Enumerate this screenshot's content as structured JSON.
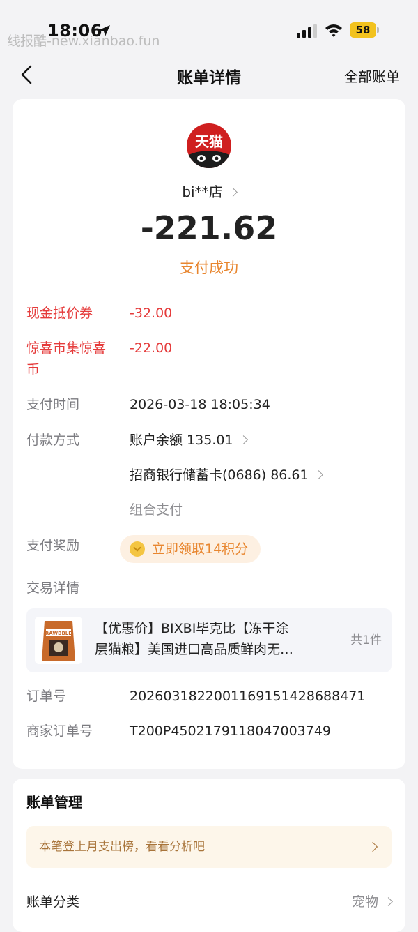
{
  "status_bar": {
    "time": "18:06",
    "battery": "58"
  },
  "watermark": "线报酷-new.xianbao.fun",
  "nav": {
    "title": "账单详情",
    "right_link": "全部账单"
  },
  "merchant": {
    "logo_text": "天猫",
    "name": "bi**店",
    "amount": "-221.62",
    "status": "支付成功"
  },
  "details": {
    "coupon_label": "现金抵价券",
    "coupon_value": "-32.00",
    "coin_label_1": "惊喜市集惊喜",
    "coin_label_2": "币",
    "coin_value": "-22.00",
    "time_label": "支付时间",
    "time_value": "2026-03-18 18:05:34",
    "method_label": "付款方式",
    "method_1": "账户余额 135.01",
    "method_2": "招商银行储蓄卡(0686) 86.61",
    "method_3": "组合支付",
    "reward_label": "支付奖励",
    "reward_text": "立即领取14积分",
    "trade_label": "交易详情",
    "order_label": "订单号",
    "order_value": "2026031822001169151428688471",
    "merchant_order_label": "商家订单号",
    "merchant_order_value": "T200P4502179118047003749"
  },
  "product": {
    "title_line1": "【优惠价】BIXBI毕克比【冻干涂",
    "title_line2": "层猫粮】美国进口高品质鲜肉无…",
    "count": "共1件",
    "thumb_text": "RAWBBLE"
  },
  "management": {
    "title": "账单管理",
    "banner_text": "本笔登上月支出榜，看看分析吧",
    "category_label": "账单分类",
    "category_value": "宠物"
  },
  "colors": {
    "accent_orange": "#e8862f",
    "discount_red": "#e53b3b",
    "tmall_red": "#cf1f1f"
  }
}
